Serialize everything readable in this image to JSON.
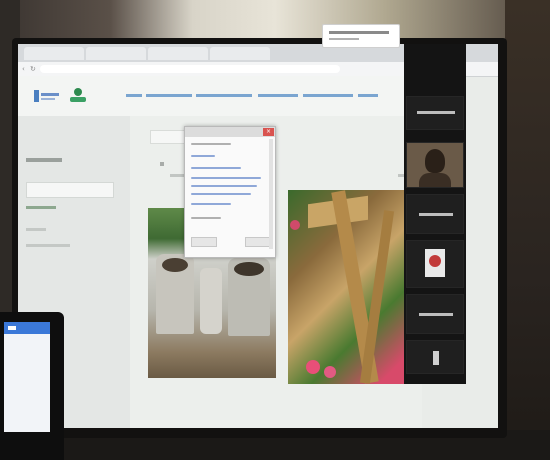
{
  "scene": {
    "description_colors": {
      "screen_bg": "#e9ece9",
      "link": "#3b7db8",
      "zoom_panel": "#141414",
      "dialog_close": "#d9534f",
      "phone_accent": "#3b78d8"
    }
  },
  "browser": {
    "tabs": [
      "",
      "",
      "",
      ""
    ],
    "url": ""
  },
  "site": {
    "nav_items": [
      "",
      "",
      "",
      "",
      "",
      ""
    ]
  },
  "dialog": {
    "title": ""
  },
  "zoom": {
    "participants": [
      "",
      "",
      "",
      "",
      ""
    ]
  },
  "icons": {
    "close": "close-icon",
    "avatar": "person-icon"
  }
}
